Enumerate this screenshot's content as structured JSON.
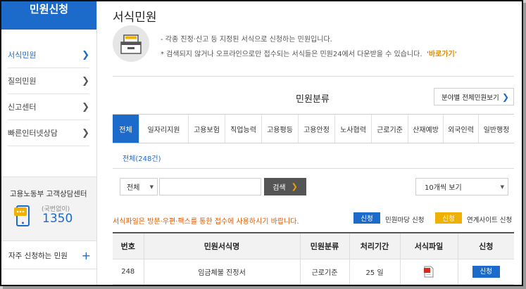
{
  "sidebar": {
    "title": "민원신청",
    "menu": [
      {
        "label": "서식민원"
      },
      {
        "label": "질의민원"
      },
      {
        "label": "신고센터"
      },
      {
        "label": "빠른인터넷상담"
      }
    ],
    "counsel_title": "고용노동부 고객상담센터",
    "counsel_hint": "(국번없이)",
    "counsel_number": "1350",
    "often_label": "자주 신청하는 민원",
    "often_plus": "+"
  },
  "main": {
    "title": "서식민원",
    "notice_1": "- 각종 진정·신고 등 지정된 서식으로 신청하는 민원입니다.",
    "notice_2": "* 검색되지 않거나 오프라인으로만 접수되는 서식들은 민원24에서 다운받을 수 있습니다.",
    "notice_link": "'바로가기'",
    "category_title": "민원분류",
    "dept_button": "분야별 전체민원보기",
    "tabs": [
      {
        "label": "전체"
      },
      {
        "label": "일자리지원"
      },
      {
        "label": "고용보험"
      },
      {
        "label": "직업능력"
      },
      {
        "label": "고용평등"
      },
      {
        "label": "고용안정"
      },
      {
        "label": "노사협력"
      },
      {
        "label": "근로기준"
      },
      {
        "label": "산재예방"
      },
      {
        "label": "외국인력"
      },
      {
        "label": "일반행정"
      }
    ],
    "sub_tab": "전체(248건)",
    "search": {
      "select_value": "전체",
      "input_value": "",
      "button": "검색",
      "page_size": "10개씩 보기"
    },
    "warning": "서식파일은 방문·우편·팩스를 통한 접수에 사용하시기 바랍니다.",
    "legend": [
      {
        "badge": "신청",
        "text": "민원마당 신청",
        "color": "#1c6ac9"
      },
      {
        "badge": "신청",
        "text": "연계사이트 신청",
        "color": "#f0b000"
      }
    ],
    "table": {
      "headers": [
        "번호",
        "민원서식명",
        "민원분류",
        "처리기간",
        "서식파일",
        "신청"
      ],
      "rows": [
        {
          "no": "248",
          "name": "임금체불 진정서",
          "category": "근로기준",
          "period": "25 일",
          "apply": "신청"
        }
      ]
    }
  },
  "colors": {
    "primary": "#1c6ac9",
    "accent": "#f0b000",
    "warning": "#e05a00"
  }
}
